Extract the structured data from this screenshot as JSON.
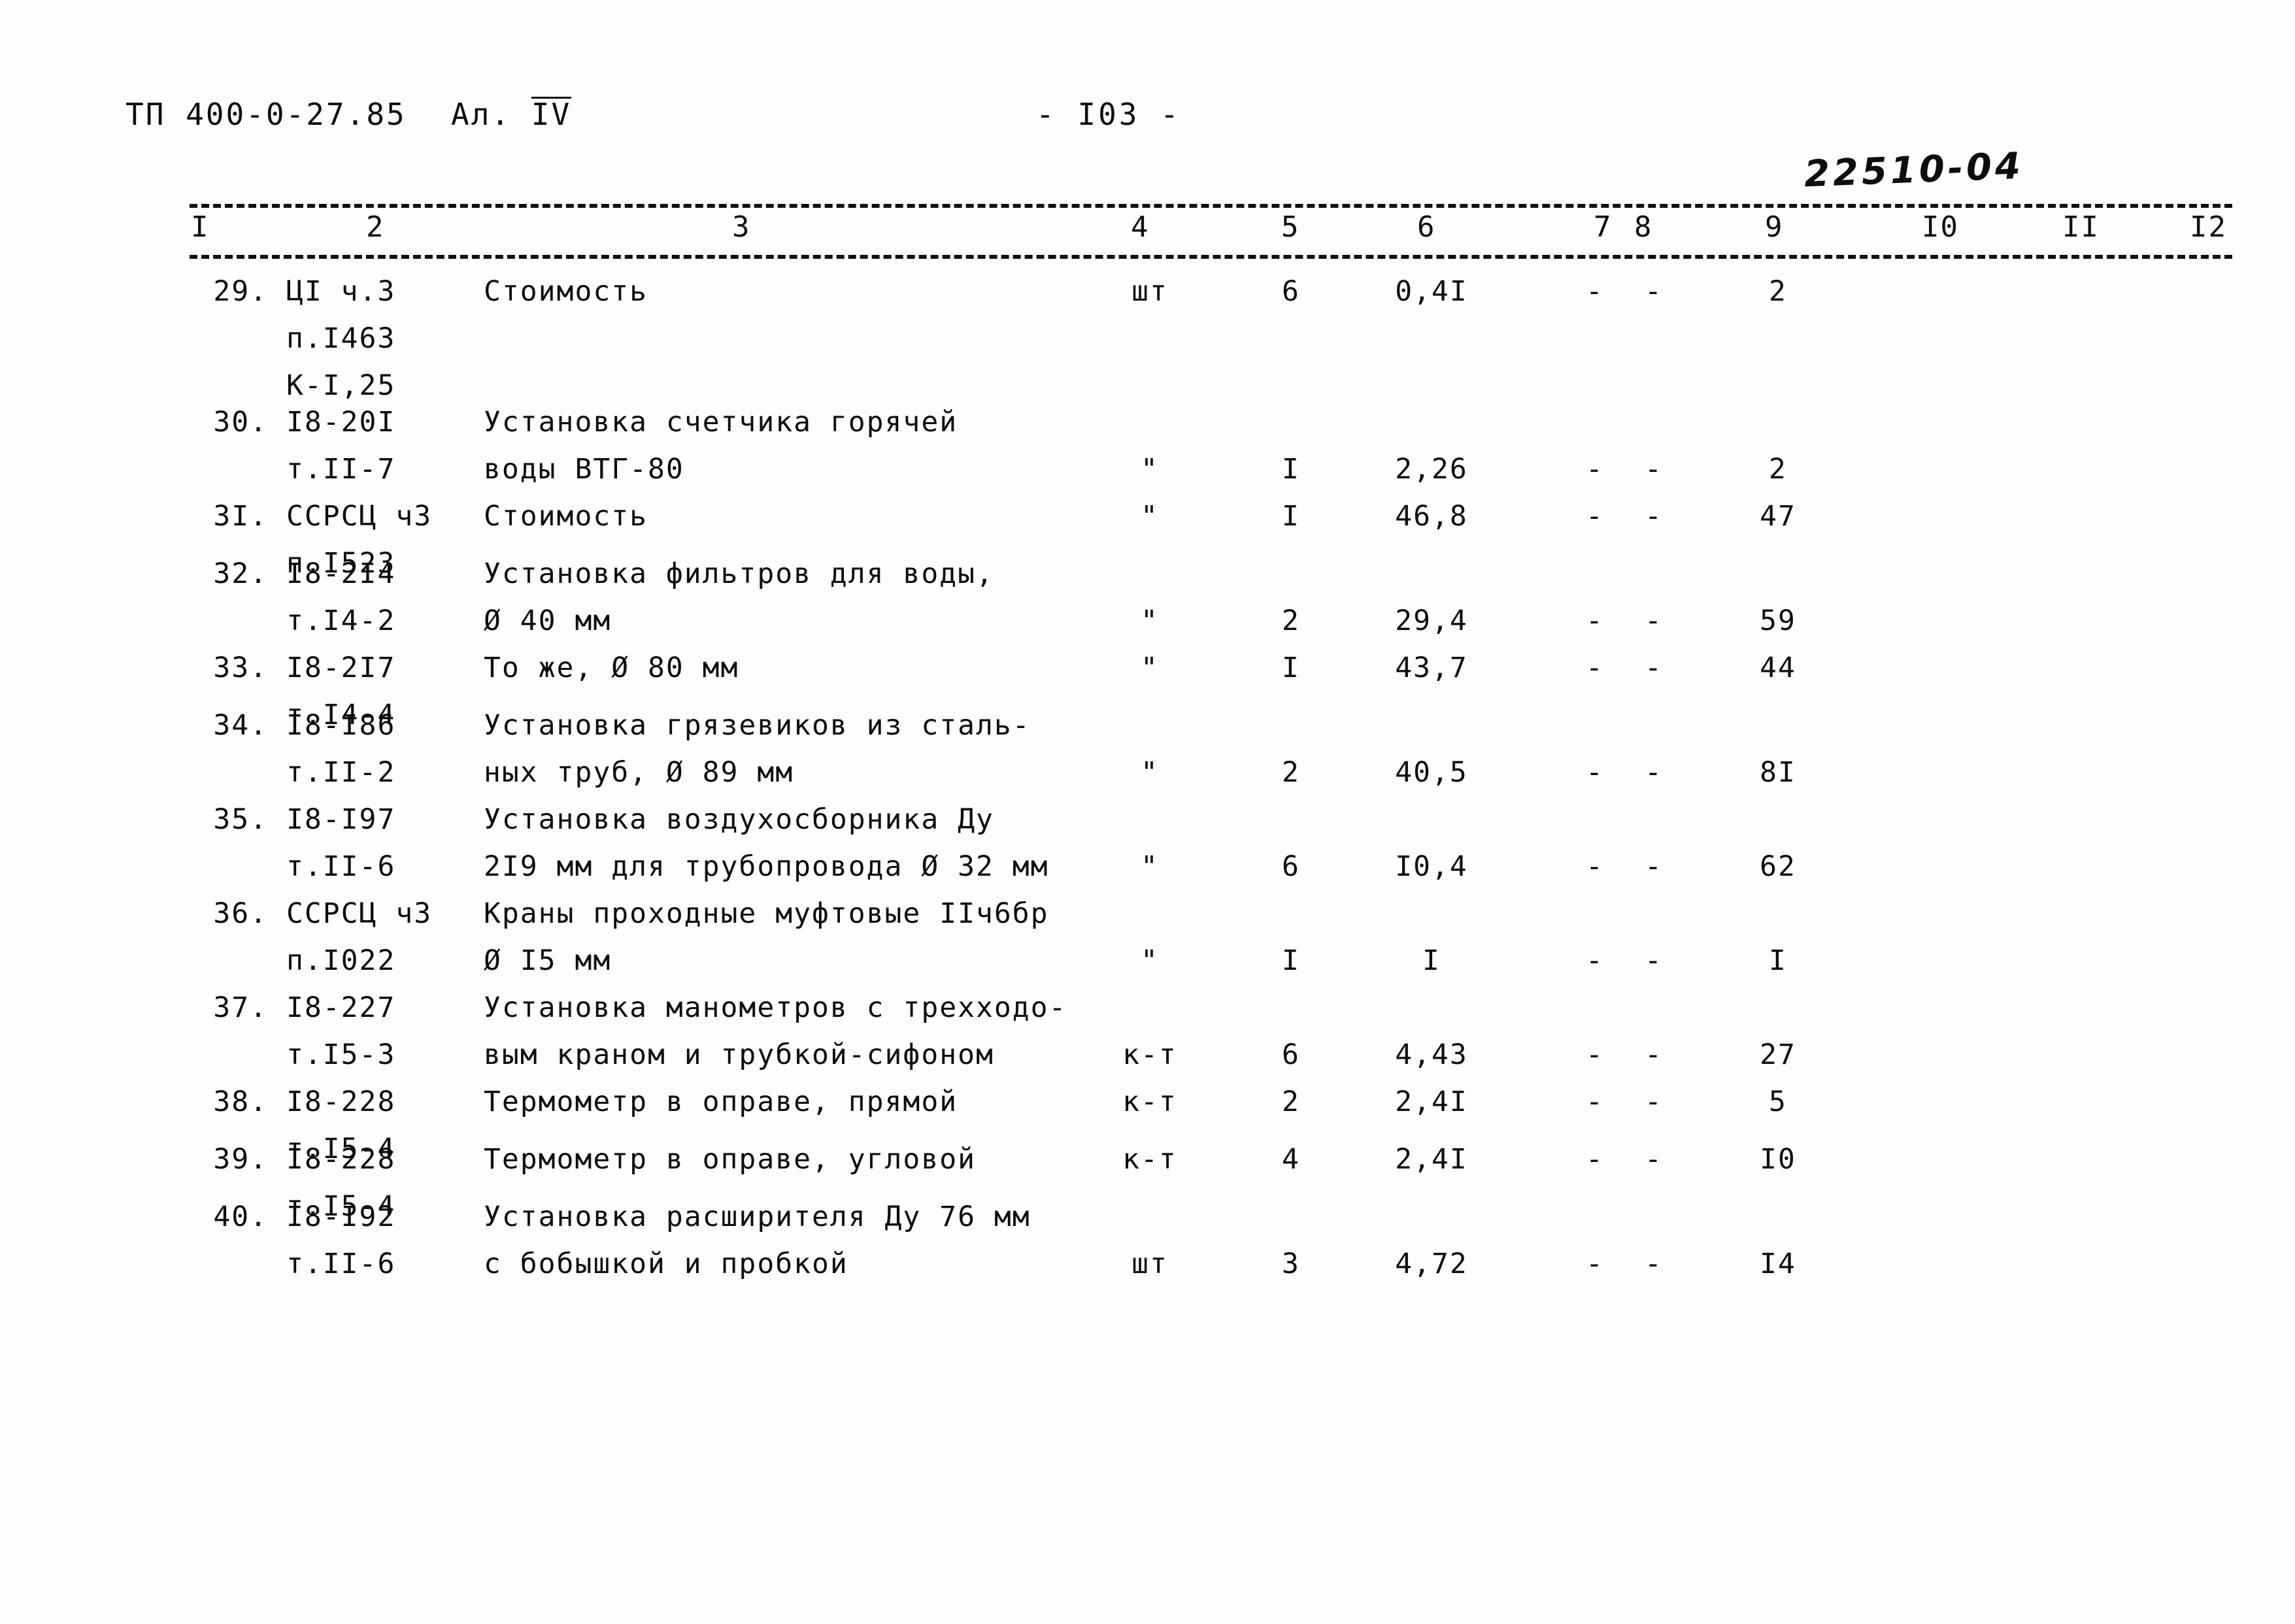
{
  "header": {
    "doc_code": "ТП 400-0-27.85",
    "album": "Ал.",
    "album_roman": "IV",
    "page_number": "- I03 -",
    "stamp": "22510-04"
  },
  "table": {
    "column_numbers": [
      "I",
      "2",
      "3",
      "4",
      "5",
      "6",
      "7",
      "8",
      "9",
      "I0",
      "II",
      "I2"
    ],
    "rows": [
      {
        "no": "29.",
        "code_line1": "ЦI ч.3",
        "code_line2": "п.I463",
        "code_line3": "К-I,25",
        "name_line1": "Стоимость",
        "name_line2": "",
        "unit": "шт",
        "qty": "6",
        "price": "0,4I",
        "d1": "-",
        "d2": "-",
        "total": "2"
      },
      {
        "no": "30.",
        "code_line1": "I8-20I",
        "code_line2": "т.II-7",
        "code_line3": "",
        "name_line1": "Установка счетчика горячей",
        "name_line2": "воды ВТГ-80",
        "unit": "\"",
        "qty": "I",
        "price": "2,26",
        "d1": "-",
        "d2": "-",
        "total": "2"
      },
      {
        "no": "3I.",
        "code_line1": "ССРСЦ ч3",
        "code_line2": "п.I523",
        "code_line3": "",
        "name_line1": "Стоимость",
        "name_line2": "",
        "unit": "\"",
        "qty": "I",
        "price": "46,8",
        "d1": "-",
        "d2": "-",
        "total": "47"
      },
      {
        "no": "32.",
        "code_line1": "I8-2I4",
        "code_line2": "т.I4-2",
        "code_line3": "",
        "name_line1": "Установка фильтров для воды,",
        "name_line2": "Ø 40 мм",
        "unit": "\"",
        "qty": "2",
        "price": "29,4",
        "d1": "-",
        "d2": "-",
        "total": "59"
      },
      {
        "no": "33.",
        "code_line1": "I8-2I7",
        "code_line2": "т.I4-4",
        "code_line3": "",
        "name_line1": "То же, Ø 80 мм",
        "name_line2": "",
        "unit": "\"",
        "qty": "I",
        "price": "43,7",
        "d1": "-",
        "d2": "-",
        "total": "44"
      },
      {
        "no": "34.",
        "code_line1": "I8-I86",
        "code_line2": "т.II-2",
        "code_line3": "",
        "name_line1": "Установка грязевиков из сталь-",
        "name_line2": "ных труб, Ø 89 мм",
        "unit": "\"",
        "qty": "2",
        "price": "40,5",
        "d1": "-",
        "d2": "-",
        "total": "8I"
      },
      {
        "no": "35.",
        "code_line1": "I8-I97",
        "code_line2": "т.II-6",
        "code_line3": "",
        "name_line1": "Установка воздухосборника Ду",
        "name_line2": "2I9 мм для трубопровода Ø 32 мм",
        "unit": "\"",
        "qty": "6",
        "price": "I0,4",
        "d1": "-",
        "d2": "-",
        "total": "62"
      },
      {
        "no": "36.",
        "code_line1": "ССРСЦ ч3",
        "code_line2": "п.I022",
        "code_line3": "",
        "name_line1": "Краны проходные муфтовые IIч6бр",
        "name_line2": "Ø I5 мм",
        "unit": "\"",
        "qty": "I",
        "price": "I",
        "d1": "-",
        "d2": "-",
        "total": "I"
      },
      {
        "no": "37.",
        "code_line1": "I8-227",
        "code_line2": "т.I5-3",
        "code_line3": "",
        "name_line1": "Установка манометров с трехходо-",
        "name_line2": "вым краном и трубкой-сифоном",
        "unit": "к-т",
        "qty": "6",
        "price": "4,43",
        "d1": "-",
        "d2": "-",
        "total": "27"
      },
      {
        "no": "38.",
        "code_line1": "I8-228",
        "code_line2": "т.I5-4",
        "code_line3": "",
        "name_line1": "Термометр в оправе, прямой",
        "name_line2": "",
        "unit": "к-т",
        "qty": "2",
        "price": "2,4I",
        "d1": "-",
        "d2": "-",
        "total": "5"
      },
      {
        "no": "39.",
        "code_line1": "I8-228",
        "code_line2": "т.I5-4",
        "code_line3": "",
        "name_line1": "Термометр в оправе, угловой",
        "name_line2": "",
        "unit": "к-т",
        "qty": "4",
        "price": "2,4I",
        "d1": "-",
        "d2": "-",
        "total": "I0"
      },
      {
        "no": "40.",
        "code_line1": "I8-I92",
        "code_line2": "т.II-6",
        "code_line3": "",
        "name_line1": "Установка расширителя Ду 76 мм",
        "name_line2": "с бобышкой и пробкой",
        "unit": "шт",
        "qty": "3",
        "price": "4,72",
        "d1": "-",
        "d2": "-",
        "total": "I4"
      }
    ]
  }
}
